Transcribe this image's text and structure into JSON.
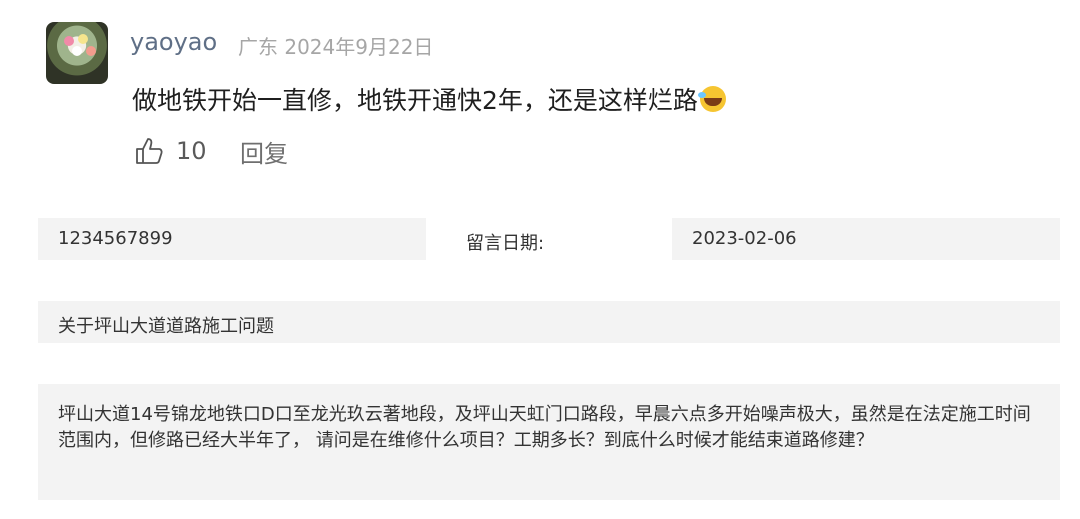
{
  "comment": {
    "username": "yaoyao",
    "location": "广东",
    "date": "2024年9月22日",
    "text": "做地铁开始一直修，地铁开通快2年，还是这样烂路",
    "emoji": "laughing-tears-emoji",
    "like_count": "10",
    "reply_label": "回复"
  },
  "detail": {
    "phone": "1234567899",
    "date_label": "留言日期:",
    "date_value": "2023-02-06",
    "subject": "关于坪山大道道路施工问题",
    "body": "坪山大道14号锦龙地铁口D口至龙光玖云著地段，及坪山天虹门口路段，早晨六点多开始噪声极大，虽然是在法定施工时间范围内，但修路已经大半年了， 请问是在维修什么项目？工期多长？到底什么时候才能结束道路修建？"
  },
  "icons": {
    "like": "thumbs-up-outline-icon",
    "avatar": "avatar-image"
  }
}
